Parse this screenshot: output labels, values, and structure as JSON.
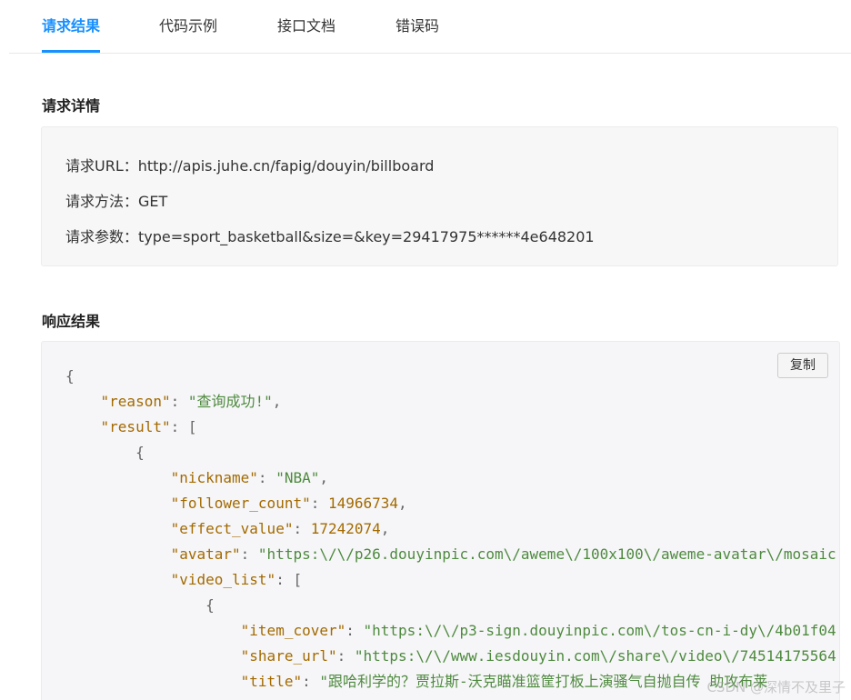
{
  "tabs": [
    {
      "label": "请求结果",
      "active": true
    },
    {
      "label": "代码示例",
      "active": false
    },
    {
      "label": "接口文档",
      "active": false
    },
    {
      "label": "错误码",
      "active": false
    }
  ],
  "request_detail": {
    "title": "请求详情",
    "url_label": "请求URL：",
    "url_value": "http://apis.juhe.cn/fapig/douyin/billboard",
    "method_label": "请求方法：",
    "method_value": "GET",
    "params_label": "请求参数：",
    "params_value": "type=sport_basketball&size=&key=29417975******4e648201"
  },
  "response": {
    "title": "响应结果",
    "copy_label": "复制",
    "lines": [
      {
        "indent": 0,
        "key": "",
        "value": "",
        "punct": "{",
        "vtype": "p"
      },
      {
        "indent": 1,
        "key": "\"reason\"",
        "value": "\"查询成功!\"",
        "punct": ",",
        "vtype": "s"
      },
      {
        "indent": 1,
        "key": "\"result\"",
        "value": "",
        "punct": "[",
        "vtype": "p"
      },
      {
        "indent": 2,
        "key": "",
        "value": "",
        "punct": "{",
        "vtype": "p"
      },
      {
        "indent": 3,
        "key": "\"nickname\"",
        "value": "\"NBA\"",
        "punct": ",",
        "vtype": "s"
      },
      {
        "indent": 3,
        "key": "\"follower_count\"",
        "value": "14966734",
        "punct": ",",
        "vtype": "n"
      },
      {
        "indent": 3,
        "key": "\"effect_value\"",
        "value": "17242074",
        "punct": ",",
        "vtype": "n"
      },
      {
        "indent": 3,
        "key": "\"avatar\"",
        "value": "\"https:\\/\\/p26.douyinpic.com\\/aweme\\/100x100\\/aweme-avatar\\/mosaic",
        "punct": "",
        "vtype": "s"
      },
      {
        "indent": 3,
        "key": "\"video_list\"",
        "value": "",
        "punct": "[",
        "vtype": "p"
      },
      {
        "indent": 4,
        "key": "",
        "value": "",
        "punct": "{",
        "vtype": "p"
      },
      {
        "indent": 5,
        "key": "\"item_cover\"",
        "value": "\"https:\\/\\/p3-sign.douyinpic.com\\/tos-cn-i-dy\\/4b01f04",
        "punct": "",
        "vtype": "s"
      },
      {
        "indent": 5,
        "key": "\"share_url\"",
        "value": "\"https:\\/\\/www.iesdouyin.com\\/share\\/video\\/74514175564",
        "punct": "",
        "vtype": "s"
      },
      {
        "indent": 5,
        "key": "\"title\"",
        "value": "\"跟哈利学的？贾拉斯-沃克瞄准篮筐打板上演骚气自抛自传 助攻布莱",
        "punct": "",
        "vtype": "s"
      }
    ]
  },
  "watermark": "CSDN @深情不及里子"
}
